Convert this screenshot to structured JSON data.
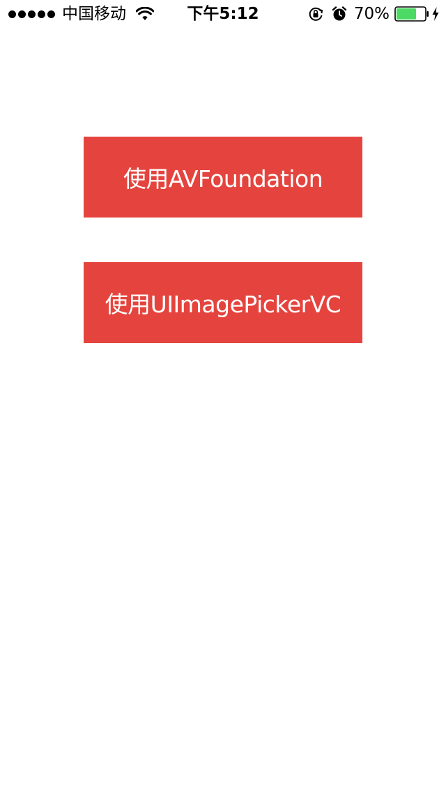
{
  "status_bar": {
    "carrier": "中国移动",
    "time": "下午5:12",
    "battery_percent": "70%",
    "battery_level": 0.7,
    "signal_bars": 5,
    "icons": [
      "signal-dots-icon",
      "wifi-icon",
      "rotation-lock-icon",
      "alarm-icon",
      "battery-icon",
      "charging-icon"
    ],
    "battery_color": "#4cd964"
  },
  "main": {
    "button_color": "#e5443e",
    "buttons": [
      {
        "label": "使用AVFoundation"
      },
      {
        "label": "使用UIImagePickerVC"
      }
    ]
  }
}
